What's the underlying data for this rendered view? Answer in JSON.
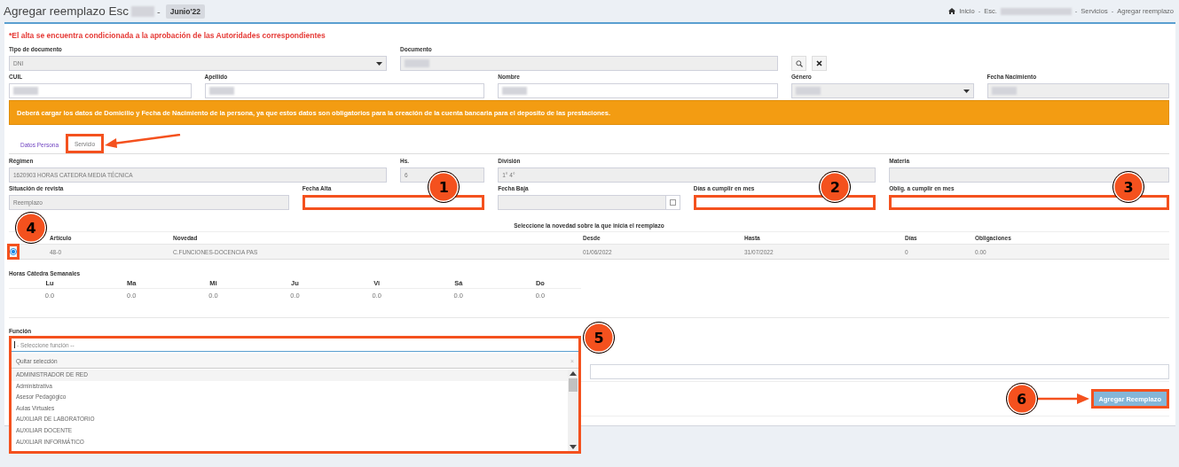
{
  "header": {
    "title": "Agregar reemplazo Esc",
    "redacted": true,
    "separator": "-",
    "badge": "Junio'22"
  },
  "breadcrumb": [
    {
      "kind": "home",
      "label": "Inicio"
    },
    {
      "kind": "separator",
      "label": "-"
    },
    {
      "kind": "link",
      "label": "Esc.",
      "redacted": true
    },
    {
      "kind": "separator",
      "label": "-"
    },
    {
      "kind": "link",
      "label": "Servicios"
    },
    {
      "kind": "separator",
      "label": "-"
    },
    {
      "kind": "current",
      "label": "Agregar reemplazo"
    }
  ],
  "notice": "*El alta se encuentra condicionada a la aprobación de las Autoridades correspondientes",
  "person_rows": [
    [
      {
        "label": "Tipo de documento",
        "kind": "select",
        "value": "DNI",
        "highlighted": false
      },
      {
        "label": "Documento",
        "kind": "readonly",
        "redacted": true,
        "highlighted": false
      }
    ],
    [
      {
        "label": "CUIL",
        "kind": "input",
        "redacted": true,
        "highlighted": false
      },
      {
        "label": "Apellido",
        "kind": "input",
        "redacted": true,
        "highlighted": false
      },
      {
        "label": "Nombre",
        "kind": "input",
        "redacted": true,
        "highlighted": false
      },
      {
        "label": "Género",
        "kind": "select",
        "redacted": true,
        "highlighted": false
      },
      {
        "label": "Fecha Nacimiento",
        "kind": "readonly",
        "redacted": true,
        "highlighted": false
      }
    ]
  ],
  "alert": "Deberá cargar los datos de Domicilio y Fecha de Nacimiento de la persona, ya que estos datos son obligatorios para la creación de la cuenta bancaria para el deposito de las prestaciones.",
  "tabs": [
    {
      "label": "Datos Persona",
      "selected": false,
      "highlighted": false,
      "arrow": false
    },
    {
      "label": "Servicio",
      "selected": true,
      "highlighted": true,
      "arrow": true
    }
  ],
  "service_rows": [
    [
      {
        "label": "Régimen",
        "kind": "readonly",
        "value": "1620903 HORAS CATEDRA MEDIA TÉCNICA",
        "highlighted": false
      },
      {
        "label": "Hs.",
        "kind": "readonly",
        "value": "6",
        "highlighted": false
      },
      {
        "label": "División",
        "kind": "readonly",
        "value": "1° 4°",
        "highlighted": false
      },
      {
        "label": "Materia",
        "kind": "readonly",
        "highlighted": false
      }
    ],
    [
      {
        "label": "Situación de revista",
        "kind": "readonly",
        "value": "Reemplazo",
        "highlighted": false
      },
      {
        "label": "Fecha Alta",
        "kind": "input",
        "highlighted": true,
        "callout": "1"
      },
      {
        "label": "Fecha Baja",
        "kind": "date-check",
        "highlighted": false,
        "checked": false
      },
      {
        "label": "Días a cumplir en mes",
        "kind": "input",
        "highlighted": true,
        "callout": "2"
      },
      {
        "label": "Oblig. a cumplir en mes",
        "kind": "input",
        "highlighted": true,
        "callout": "3"
      }
    ]
  ],
  "novedades": {
    "title": "Seleccione la novedad sobre la que inicia el reemplazo",
    "columns": [
      "Artículo",
      "Novedad",
      "Desde",
      "Hasta",
      "Días",
      "Obligaciones"
    ],
    "rows": [
      {
        "selected": true,
        "highlighted": true,
        "callout": "4",
        "cells": [
          "48-0",
          "C.FUNCIONES-DOCENCIA PAS",
          "01/06/2022",
          "31/07/2022",
          "0",
          "0.00"
        ]
      }
    ]
  },
  "weekly_hours": {
    "title": "Horas Cátedra Semanales",
    "days": [
      {
        "day": "Lu",
        "value": "0.0"
      },
      {
        "day": "Ma",
        "value": "0.0"
      },
      {
        "day": "Mi",
        "value": "0.0"
      },
      {
        "day": "Ju",
        "value": "0.0"
      },
      {
        "day": "Vi",
        "value": "0.0"
      },
      {
        "day": "Sá",
        "value": "0.0"
      },
      {
        "day": "Do",
        "value": "0.0"
      }
    ]
  },
  "function": {
    "label": "Función",
    "placeholder": "- Seleccione función --",
    "open": true,
    "highlighted": true,
    "callout": "5",
    "clear_label": "Quitar selección",
    "clear_icon": "×",
    "options": [
      {
        "label": "ADMINISTRADOR DE RED",
        "selected": true
      },
      {
        "label": "Administrativa",
        "selected": false
      },
      {
        "label": "Asesor Pedagógico",
        "selected": false
      },
      {
        "label": "Aulas Virtuales",
        "selected": false
      },
      {
        "label": "AUXILIAR DE LABORATORIO",
        "selected": false
      },
      {
        "label": "AUXILIAR DOCENTE",
        "selected": false
      },
      {
        "label": "AUXILIAR INFORMÁTICO",
        "selected": false
      }
    ]
  },
  "submit": {
    "label": "Agregar Reemplazo",
    "highlighted": true,
    "callout": "6",
    "arrow": true
  }
}
